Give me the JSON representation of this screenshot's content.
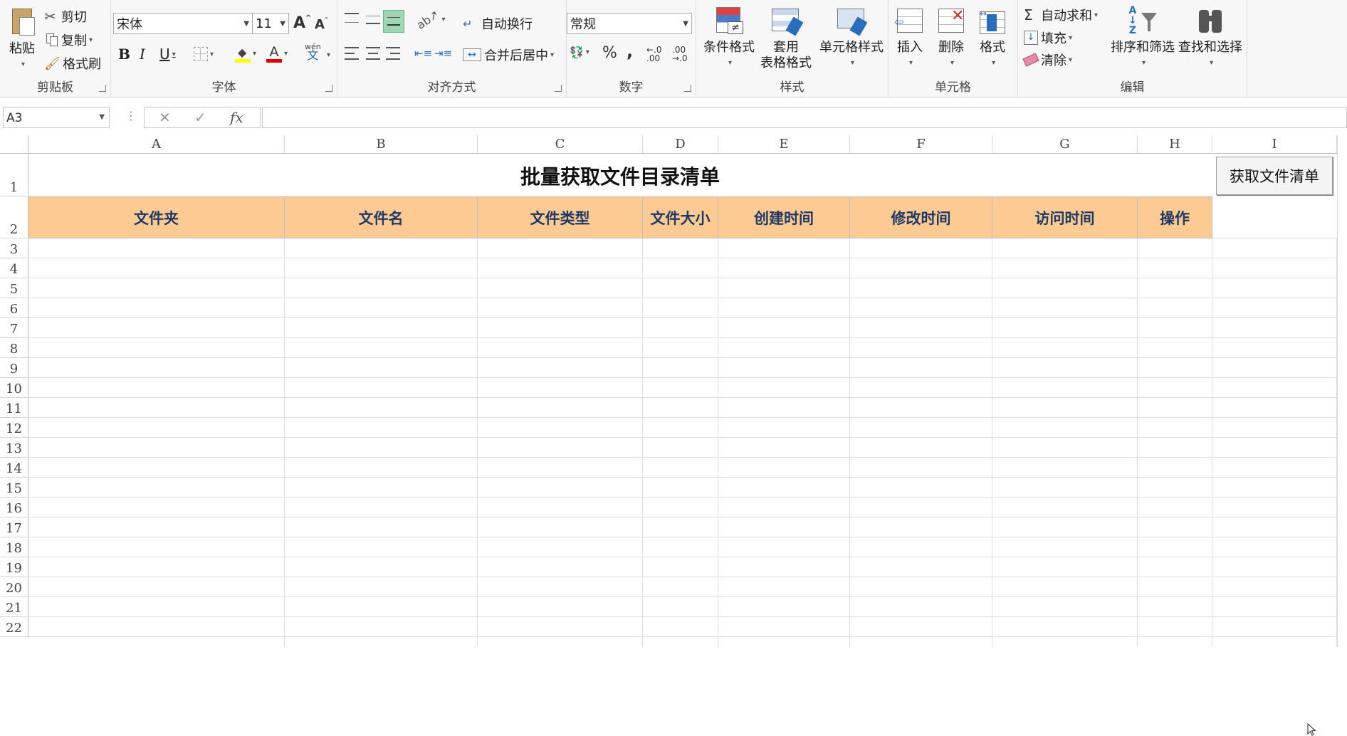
{
  "clipboard": {
    "paste": "粘贴",
    "cut": "剪切",
    "copy": "复制",
    "format_painter": "格式刷",
    "group": "剪贴板"
  },
  "font": {
    "name": "宋体",
    "size": "11",
    "bold": "B",
    "italic": "I",
    "underline": "U",
    "phonetic": "wén",
    "phonetic_char": "文",
    "grow": "A",
    "shrink": "A",
    "group": "字体"
  },
  "alignment": {
    "wrap": "自动换行",
    "merge": "合并后居中",
    "group": "对齐方式"
  },
  "number": {
    "format": "常规",
    "percent": "%",
    "comma": ",",
    "inc_decimal": "←.0 .00",
    "dec_decimal": ".00 →.0",
    "group": "数字"
  },
  "styles": {
    "conditional": "条件格式",
    "table_line1": "套用",
    "table_line2": "表格格式",
    "cell_styles": "单元格样式",
    "group": "样式"
  },
  "cells": {
    "insert": "插入",
    "delete": "删除",
    "format": "格式",
    "group": "单元格"
  },
  "editing": {
    "autosum": "自动求和",
    "fill": "填充",
    "clear": "清除",
    "sort": "排序和筛选",
    "find": "查找和选择",
    "group": "编辑"
  },
  "formula_bar": {
    "name_box": "A3",
    "fx": "fx",
    "formula": ""
  },
  "columns": [
    "A",
    "B",
    "C",
    "D",
    "E",
    "F",
    "G",
    "H",
    "I"
  ],
  "rows": [
    "1",
    "2",
    "3",
    "4",
    "5",
    "6",
    "7",
    "8",
    "9",
    "10",
    "11",
    "12",
    "13",
    "14",
    "15",
    "16",
    "17",
    "18",
    "19",
    "20",
    "21",
    "22"
  ],
  "sheet": {
    "title": "批量获取文件目录清单",
    "headers": [
      "文件夹",
      "文件名",
      "文件类型",
      "文件大小",
      "创建时间",
      "修改时间",
      "访问时间",
      "操作"
    ],
    "button": "获取文件清单"
  },
  "colors": {
    "header_fill": "#fcca92",
    "header_text": "#1f3864",
    "accent_green": "#217346"
  }
}
